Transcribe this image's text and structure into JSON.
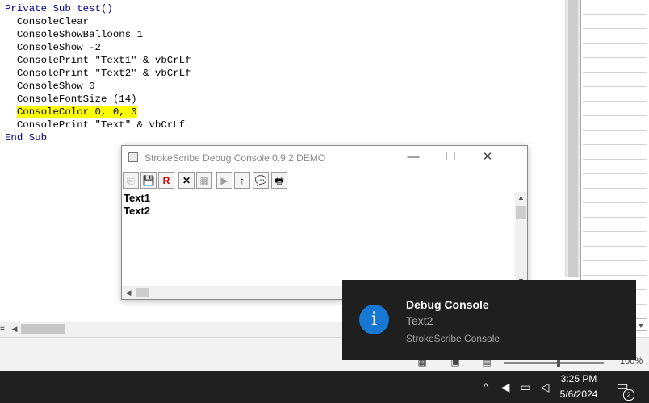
{
  "editor": {
    "lines": [
      {
        "kind": "keyword-line",
        "text": "Private Sub test()"
      },
      {
        "kind": "code",
        "text": "  ConsoleClear"
      },
      {
        "kind": "code",
        "text": "  ConsoleShowBalloons 1"
      },
      {
        "kind": "code",
        "text": "  ConsoleShow -2"
      },
      {
        "kind": "code",
        "text": "  ConsolePrint \"Text1\" & vbCrLf"
      },
      {
        "kind": "code",
        "text": "  ConsolePrint \"Text2\" & vbCrLf"
      },
      {
        "kind": "code",
        "text": "  ConsoleShow 0"
      },
      {
        "kind": "code",
        "text": "  ConsoleFontSize (14)"
      },
      {
        "kind": "highlight",
        "indent": "  ",
        "text": "ConsoleColor 0, 0, 0"
      },
      {
        "kind": "code",
        "text": "  ConsolePrint \"Text\" & vbCrLf"
      },
      {
        "kind": "keyword-line",
        "text": "End Sub"
      }
    ],
    "highlight_color": "#ffff00",
    "keyword_color": "#00008b"
  },
  "console_window": {
    "title": "StrokeScribe Debug Console 0.9.2 DEMO",
    "minimize_glyph": "—",
    "maximize_glyph": "☐",
    "close_glyph": "✕",
    "toolbar": [
      {
        "name": "copy-button",
        "glyph": "⎘",
        "enabled": false
      },
      {
        "name": "save-button",
        "glyph": "💾",
        "enabled": true
      },
      {
        "name": "reset-button",
        "glyph": "R",
        "enabled": true
      },
      {
        "name": "clear-button",
        "glyph": "✕",
        "enabled": true
      },
      {
        "name": "paste-button",
        "glyph": "▦",
        "enabled": false
      },
      {
        "name": "run-button",
        "glyph": "▶",
        "enabled": false
      },
      {
        "name": "scroll-up-button",
        "glyph": "↑",
        "enabled": true
      },
      {
        "name": "balloon-button",
        "glyph": "💬",
        "enabled": true
      },
      {
        "name": "print-button",
        "glyph": "🖶",
        "enabled": true
      }
    ],
    "output_lines": [
      "Text1",
      "Text2"
    ]
  },
  "toast": {
    "title": "Debug Console",
    "message": "Text2",
    "source": "StrokeScribe Console",
    "icon_glyph": "i",
    "icon_color": "#1778d3"
  },
  "status_bar": {
    "zoom": "100%"
  },
  "taskbar": {
    "time": "3:25 PM",
    "date": "5/6/2024",
    "notification_count": "2"
  }
}
